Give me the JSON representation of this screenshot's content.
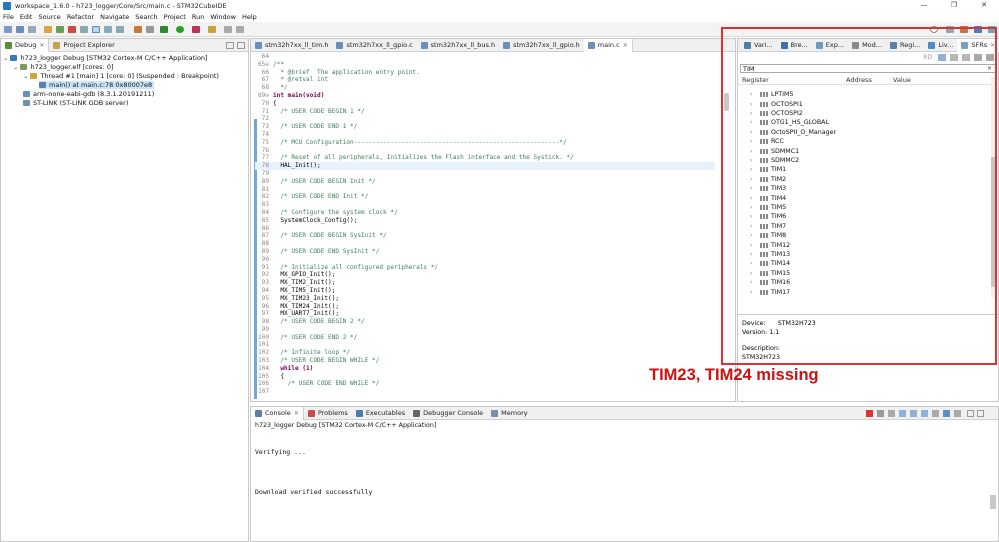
{
  "window": {
    "title": "workspace_1.6.0 - h723_logger/Core/Src/main.c - STM32CubeIDE",
    "controls": [
      "—",
      "❐",
      "✕"
    ]
  },
  "menu": [
    "File",
    "Edit",
    "Source",
    "Refactor",
    "Navigate",
    "Search",
    "Project",
    "Run",
    "Window",
    "Help"
  ],
  "debug_view": {
    "tabs": [
      {
        "label": "Debug",
        "icon": "debug-icon"
      },
      {
        "label": "Project Explorer",
        "icon": "project-explorer-icon"
      }
    ],
    "tree": [
      {
        "text": "h723_logger Debug [STM32 Cortex-M C/C++ Application]",
        "icon": "launch-config-icon",
        "level": 0,
        "expanded": true
      },
      {
        "text": "h723_logger.elf [cores: 0]",
        "icon": "elf-icon",
        "level": 1,
        "expanded": true
      },
      {
        "text": "Thread #1 [main] 1 [core: 0] (Suspended : Breakpoint)",
        "icon": "thread-icon",
        "level": 2,
        "expanded": true
      },
      {
        "text": "main() at main.c:78 0x80007e8",
        "icon": "stack-frame-icon",
        "level": 3,
        "selected": true
      },
      {
        "text": "arm-none-eabi-gdb (8.3.1.20191211)",
        "icon": "gdb-icon",
        "level": 1
      },
      {
        "text": "ST-LINK (ST-LINK GDB server)",
        "icon": "stlink-icon",
        "level": 1
      }
    ]
  },
  "editor": {
    "tabs": [
      "stm32h7xx_ll_tim.h",
      "stm32h7xx_ll_gpio.c",
      "stm32h7xx_ll_bus.h",
      "stm32h7xx_ll_gpio.h",
      "main.c"
    ],
    "active_tab": "main.c",
    "lines": [
      {
        "n": "64",
        "text": "",
        "kind": "normal"
      },
      {
        "n": "65⊖",
        "text": "/**",
        "kind": "comment"
      },
      {
        "n": "66",
        "text": "  * @brief  The application entry point.",
        "kind": "comment"
      },
      {
        "n": "67",
        "text": "  * @retval int",
        "kind": "comment"
      },
      {
        "n": "68",
        "text": "  */",
        "kind": "comment"
      },
      {
        "n": "69⊖",
        "text": "int main(void)",
        "kind": "keyword"
      },
      {
        "n": "70",
        "text": "{",
        "kind": "normal"
      },
      {
        "n": "71",
        "text": "  /* USER CODE BEGIN 1 */",
        "kind": "comment"
      },
      {
        "n": "72",
        "text": "",
        "kind": "normal"
      },
      {
        "n": "73",
        "text": "  /* USER CODE END 1 */",
        "kind": "comment"
      },
      {
        "n": "74",
        "text": "",
        "kind": "normal"
      },
      {
        "n": "75",
        "text": "  /* MCU Configuration--------------------------------------------------------*/",
        "kind": "comment"
      },
      {
        "n": "76",
        "text": "",
        "kind": "normal"
      },
      {
        "n": "77",
        "text": "  /* Reset of all peripherals, Initializes the Flash interface and the Systick. */",
        "kind": "comment"
      },
      {
        "n": "78",
        "text": "  HAL_Init();",
        "kind": "highlight"
      },
      {
        "n": "79",
        "text": "",
        "kind": "normal"
      },
      {
        "n": "80",
        "text": "  /* USER CODE BEGIN Init */",
        "kind": "comment"
      },
      {
        "n": "81",
        "text": "",
        "kind": "normal"
      },
      {
        "n": "82",
        "text": "  /* USER CODE END Init */",
        "kind": "comment"
      },
      {
        "n": "83",
        "text": "",
        "kind": "normal"
      },
      {
        "n": "84",
        "text": "  /* Configure the system clock */",
        "kind": "comment"
      },
      {
        "n": "85",
        "text": "  SystemClock_Config();",
        "kind": "normal"
      },
      {
        "n": "86",
        "text": "",
        "kind": "normal"
      },
      {
        "n": "87",
        "text": "  /* USER CODE BEGIN SysInit */",
        "kind": "comment"
      },
      {
        "n": "88",
        "text": "",
        "kind": "normal"
      },
      {
        "n": "89",
        "text": "  /* USER CODE END SysInit */",
        "kind": "comment"
      },
      {
        "n": "90",
        "text": "",
        "kind": "normal"
      },
      {
        "n": "91",
        "text": "  /* Initialize all configured peripherals */",
        "kind": "comment"
      },
      {
        "n": "92",
        "text": "  MX_GPIO_Init();",
        "kind": "normal"
      },
      {
        "n": "93",
        "text": "  MX_TIM2_Init();",
        "kind": "normal"
      },
      {
        "n": "94",
        "text": "  MX_TIM5_Init();",
        "kind": "normal"
      },
      {
        "n": "95",
        "text": "  MX_TIM23_Init();",
        "kind": "normal"
      },
      {
        "n": "96",
        "text": "  MX_TIM24_Init();",
        "kind": "normal"
      },
      {
        "n": "97",
        "text": "  MX_UART7_Init();",
        "kind": "normal"
      },
      {
        "n": "98",
        "text": "  /* USER CODE BEGIN 2 */",
        "kind": "comment"
      },
      {
        "n": "99",
        "text": "",
        "kind": "normal"
      },
      {
        "n": "100",
        "text": "  /* USER CODE END 2 */",
        "kind": "comment"
      },
      {
        "n": "101",
        "text": "",
        "kind": "normal"
      },
      {
        "n": "102",
        "text": "  /* Infinite loop */",
        "kind": "comment"
      },
      {
        "n": "103",
        "text": "  /* USER CODE BEGIN WHILE */",
        "kind": "comment"
      },
      {
        "n": "104",
        "text": "  while (1)",
        "kind": "keyword"
      },
      {
        "n": "105",
        "text": "  {",
        "kind": "normal"
      },
      {
        "n": "106",
        "text": "    /* USER CODE END WHILE */",
        "kind": "comment"
      },
      {
        "n": "107",
        "text": "",
        "kind": "normal"
      }
    ]
  },
  "sfr_view": {
    "tabs": [
      "Vari...",
      "Bre...",
      "Exp...",
      "Mod...",
      "Regi...",
      "Liv...",
      "SFRs"
    ],
    "active_tab": "SFRs",
    "toolbar_rd_label": "RD",
    "filter_value": "TIM",
    "columns": [
      "Register",
      "Address",
      "Value"
    ],
    "registers": [
      "LPTIM5",
      "OCTOSPI1",
      "OCTOSPI2",
      "OTG1_HS_GLOBAL",
      "OctoSPII_O_Manager",
      "RCC",
      "SDMMC1",
      "SDMMC2",
      "TIM1",
      "TIM2",
      "TIM3",
      "TIM4",
      "TIM5",
      "TIM6",
      "TIM7",
      "TIM8",
      "TIM12",
      "TIM13",
      "TIM14",
      "TIM15",
      "TIM16",
      "TIM17"
    ],
    "device_label": "Device:",
    "device_value": "STM32H723",
    "version_text": "Version: 1.1",
    "description_label": "Description:",
    "description_value": "STM32H723"
  },
  "console": {
    "tabs": [
      "Console",
      "Problems",
      "Executables",
      "Debugger Console",
      "Memory"
    ],
    "header": "h723_logger Debug [STM32 Cortex-M C/C++ Application]",
    "lines": [
      "Verifying ...",
      "Download verified successfully"
    ]
  },
  "annotation": "TIM23, TIM24 missing",
  "colors": {
    "annotation_red": "#d01010",
    "line_highlight": "#e8f2fe",
    "selection": "#cce4f7",
    "comment_green": "#3f7f5f",
    "keyword_purple": "#7f0055"
  }
}
